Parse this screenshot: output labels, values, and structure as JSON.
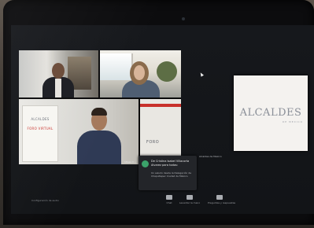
{
  "meeting": {
    "participants": [
      {
        "name": ""
      },
      {
        "name": ""
      },
      {
        "name": "Ulises C..."
      },
      {
        "name": ""
      }
    ],
    "backdrop_banner": {
      "line1": "ALCALDES",
      "line2": "FORO VIRTUAL"
    },
    "side_logo": "FORO",
    "side_tile": {
      "logo": "ALCALDES",
      "subtitle": "DE MEXICO"
    },
    "side_label": "Alcaldes de Mexico"
  },
  "toast": {
    "title": "De Cristina Isabel Villacorta Alvarez para todos:",
    "body": "Un saludo desde la Delegación de Chapultepec Ciudad de México."
  },
  "toolbar": {
    "left_label": "Configuración de audio",
    "buttons": [
      {
        "label": "Chat",
        "icon": "chat-icon"
      },
      {
        "label": "Levantar la mano",
        "icon": "raise-hand-icon"
      },
      {
        "label": "Preguntas y respuestas",
        "icon": "qa-icon"
      }
    ]
  }
}
